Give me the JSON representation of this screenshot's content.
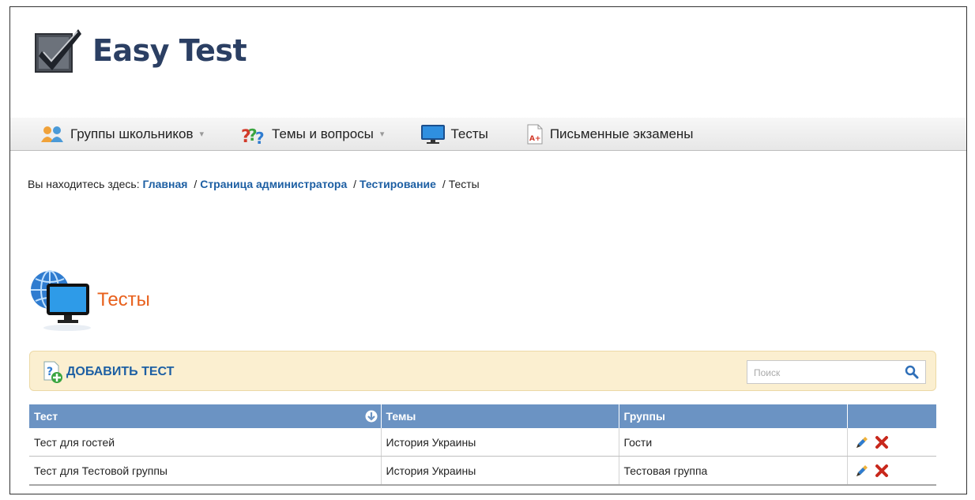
{
  "app": {
    "name": "Easy Test"
  },
  "nav": {
    "items": [
      {
        "label": "Группы школьников",
        "icon": "users-icon",
        "has_dropdown": true
      },
      {
        "label": "Темы и вопросы",
        "icon": "question-icon",
        "has_dropdown": true
      },
      {
        "label": "Тесты",
        "icon": "monitor-icon",
        "has_dropdown": false
      },
      {
        "label": "Письменные экзамены",
        "icon": "document-grade-icon",
        "has_dropdown": false
      }
    ]
  },
  "breadcrumb": {
    "prefix": "Вы находитесь здесь:",
    "links": [
      "Главная",
      "Страница администратора",
      "Тестирование"
    ],
    "current": "Тесты"
  },
  "page": {
    "title": "Тесты"
  },
  "toolbar": {
    "add_label": "ДОБАВИТЬ ТЕСТ",
    "search_placeholder": "Поиск",
    "search_value": ""
  },
  "table": {
    "columns": [
      "Тест",
      "Темы",
      "Группы",
      ""
    ],
    "sort_column": "Тест",
    "rows": [
      {
        "test": "Тест для гостей",
        "topics": "История Украины",
        "groups": "Гости"
      },
      {
        "test": "Тест для Тестовой группы",
        "topics": "История Украины",
        "groups": "Тестовая группа"
      }
    ]
  },
  "colors": {
    "accent": "#e8601c",
    "link": "#1d5fa3",
    "table_header": "#6b93c3",
    "toolbar_bg": "#fbefd0",
    "brand": "#2b3f63"
  }
}
